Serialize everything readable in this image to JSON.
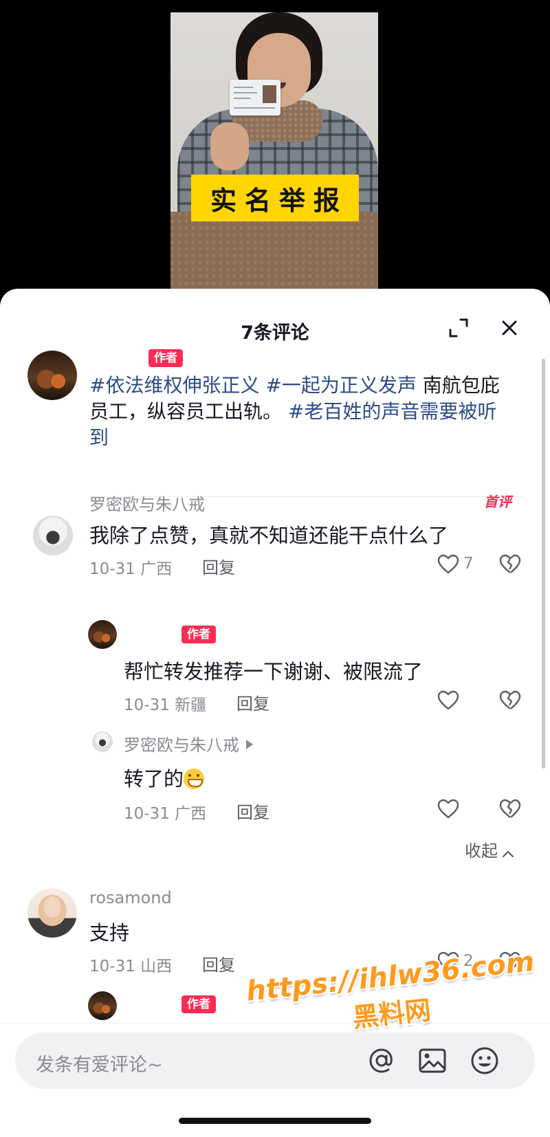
{
  "video": {
    "banner_text": "实名举报"
  },
  "sheet": {
    "title": "7条评论"
  },
  "post": {
    "author_tag": "作者",
    "hashtag1": "#依法维权伸张正义",
    "hashtag2": "#一起为正义发声",
    "text1": " 南航包庇员工，纵容员工出轨。",
    "hashtag3": "#老百姓的声音需要被听到"
  },
  "comments": [
    {
      "username": "罗密欧与朱八戒",
      "badge": "首评",
      "text": "我除了点赞，真就不知道还能干点什么了",
      "date": "10-31",
      "location": "广西",
      "reply_label": "回复",
      "likes": "7",
      "replies": [
        {
          "author_tag": "作者",
          "text": "帮忙转发推荐一下谢谢、被限流了",
          "date": "10-31",
          "location": "新疆",
          "reply_label": "回复"
        },
        {
          "username": "罗密欧与朱八戒",
          "text": "转了的",
          "date": "10-31",
          "location": "广西",
          "reply_label": "回复"
        }
      ],
      "collapse_label": "收起"
    },
    {
      "username": "rosamond",
      "text": "支持",
      "date": "10-31",
      "location": "山西",
      "reply_label": "回复",
      "likes": "2"
    },
    {
      "author_tag": "作者"
    }
  ],
  "input": {
    "placeholder": "发条有爱评论~"
  },
  "watermark": {
    "url": "https://ihlw36.com",
    "name": "黑料网"
  },
  "colors": {
    "accent": "#fe2c55",
    "hashtag": "#2c4b87",
    "banner": "#ffd500"
  }
}
